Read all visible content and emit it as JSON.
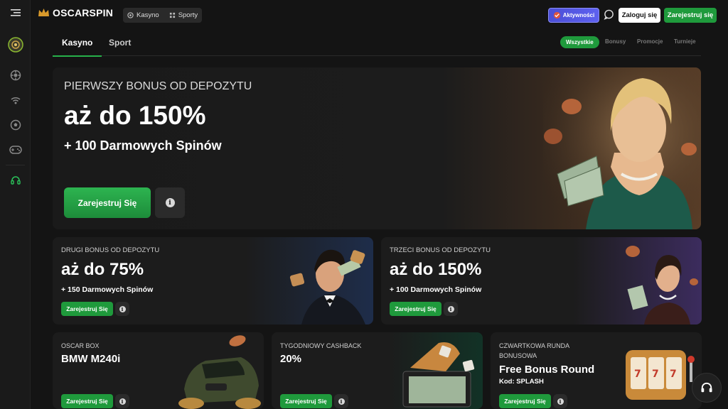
{
  "brand": {
    "name": "OSCARSPIN"
  },
  "topnav": {
    "casino": "Kasyno",
    "sports": "Sporty"
  },
  "header": {
    "activity": "Aktywności",
    "login": "Zaloguj się",
    "register": "Zarejestruj się"
  },
  "tabs": {
    "casino": "Kasyno",
    "sport": "Sport"
  },
  "filters": [
    "Wszystkie",
    "Bonusy",
    "Promocje",
    "Turnieje"
  ],
  "hero": {
    "kicker": "PIERWSZY BONUS OD DEPOZYTU",
    "title": "aż do 150%",
    "subtitle": "+ 100 Darmowych Spinów",
    "cta": "Zarejestruj Się",
    "info": "i"
  },
  "cards_mid": [
    {
      "kicker": "DRUGI BONUS OD DEPOZYTU",
      "title": "aż do 75%",
      "subtitle": "+ 150 Darmowych Spinów",
      "cta": "Zarejestruj Się",
      "info": "i"
    },
    {
      "kicker": "TRZECI BONUS OD DEPOZYTU",
      "title": "aż do 150%",
      "subtitle": "+ 100 Darmowych Spinów",
      "cta": "Zarejestruj Się",
      "info": "i"
    }
  ],
  "cards_bottom": [
    {
      "kicker": "OSCAR BOX",
      "title": "BMW M240i",
      "cta": "Zarejestruj Się",
      "info": "i"
    },
    {
      "kicker": "TYGODNIOWY CASHBACK",
      "title": "20%",
      "cta": "Zarejestruj Się",
      "info": "i"
    },
    {
      "kicker1": "CZWARTKOWA RUNDA",
      "kicker2": "BONUSOWA",
      "title": "Free Bonus Round",
      "code": "Kod: SPLASH",
      "cta": "Zarejestruj Się",
      "info": "i"
    }
  ],
  "colors": {
    "accent_green": "#1f9a3c",
    "activity_purple": "#5e61f0",
    "background": "#141414",
    "card": "#1c1c1c"
  }
}
